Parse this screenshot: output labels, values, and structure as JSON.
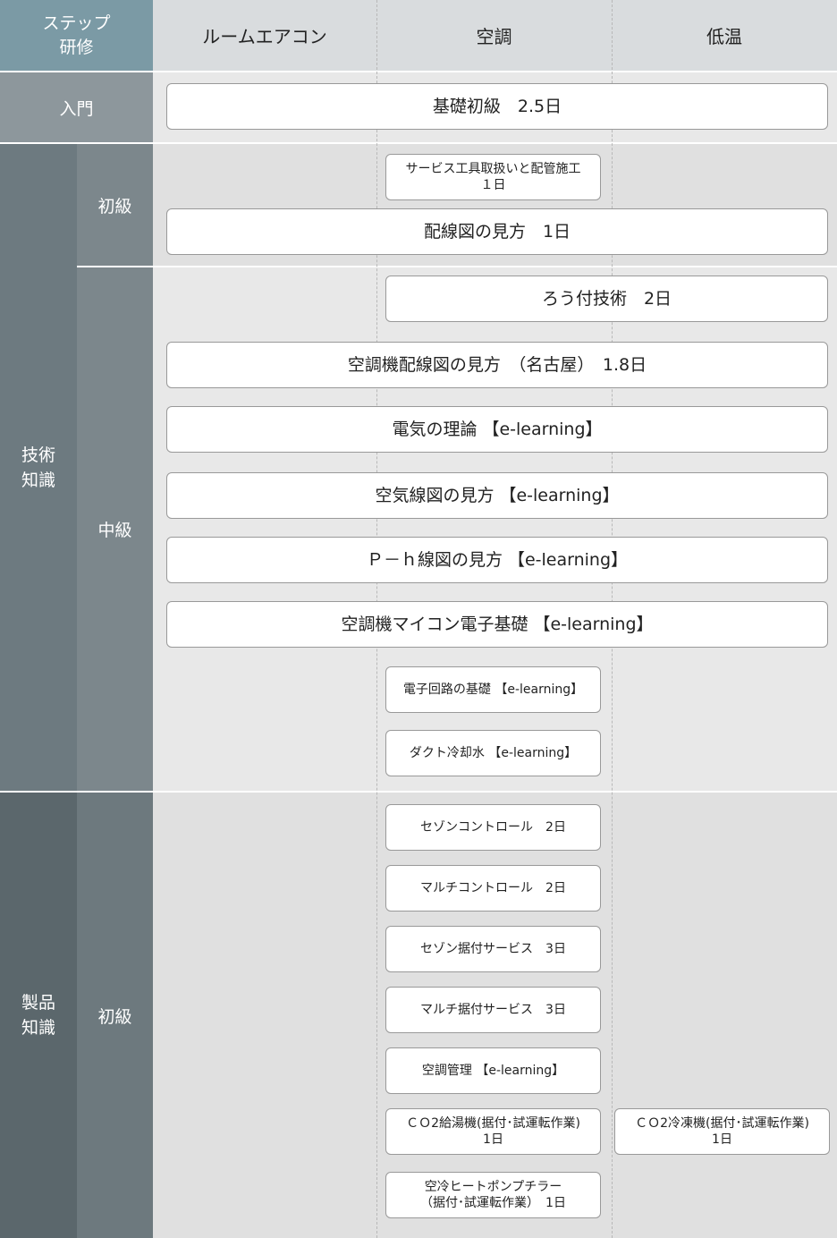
{
  "header": {
    "step_label": "ステップ\n研修",
    "columns": [
      "ルームエアコン",
      "空調",
      "低温"
    ]
  },
  "sections": {
    "intro": {
      "label": "入門"
    },
    "tech": {
      "label": "技術\n知識",
      "levels": [
        "初級",
        "中級"
      ]
    },
    "product": {
      "label": "製品\n知識",
      "level": "初級"
    }
  },
  "courses": {
    "intro_basic": "基礎初級　2.5日",
    "service_tools": "サービス工具取扱いと配管施工\n１日",
    "wiring_1": "配線図の見方　1日",
    "brazing": "ろう付技術　2日",
    "ac_wiring": "空調機配線図の見方　（名古屋）　1.8日",
    "elec_theory": "電気の理論 【e-learning】",
    "air_diagram": "空気線図の見方 【e-learning】",
    "ph_diagram": "Ｐ－ｈ線図の見方 【e-learning】",
    "microcomputer": "空調機マイコン電子基礎 【e-learning】",
    "circuit_basics": "電子回路の基礎 【e-learning】",
    "duct_water": "ダクト冷却水 【e-learning】",
    "season_control": "セゾンコントロール　2日",
    "multi_control": "マルチコントロール　2日",
    "season_install": "セゾン据付サービス　3日",
    "multi_install": "マルチ据付サービス　3日",
    "ac_management": "空調管理 【e-learning】",
    "co2_water_heater": "ＣＯ2給湯機(据付･試運転作業)\n1日",
    "co2_freezer": "ＣＯ2冷凍機(据付･試運転作業)\n1日",
    "heat_pump_chiller": "空冷ヒートポンプチラー\n（据付･試運転作業）　1日"
  }
}
